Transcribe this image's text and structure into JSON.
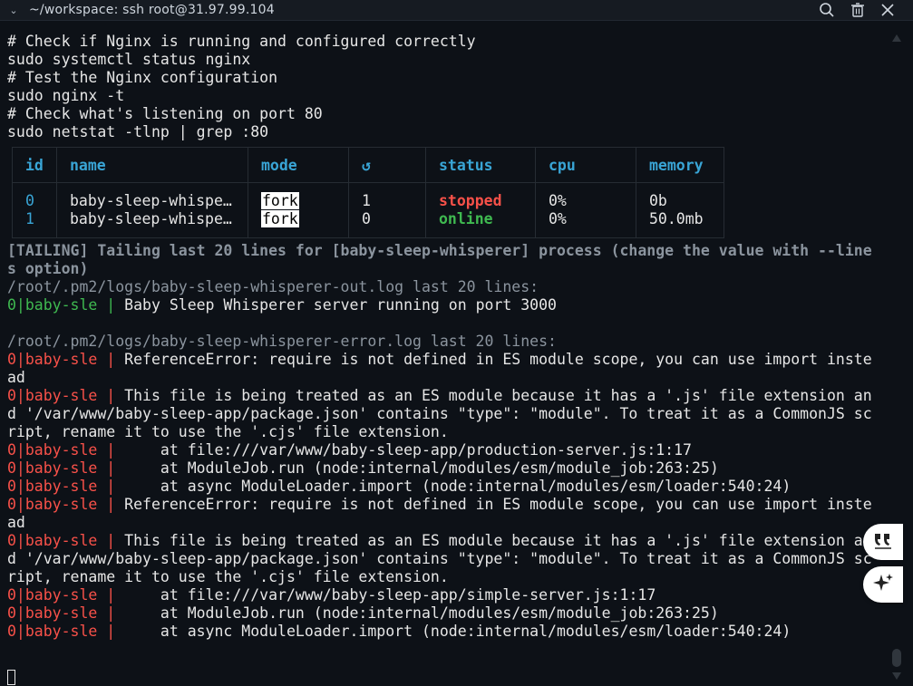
{
  "titlebar": {
    "chevron_icon": "chevron-down-icon",
    "title": "~/workspace: ssh root@31.97.99.104",
    "icons": [
      "search-icon",
      "trash-icon",
      "close-icon"
    ]
  },
  "commands": [
    "# Check if Nginx is running and configured correctly",
    "sudo systemctl status nginx",
    "# Test the Nginx configuration",
    "sudo nginx -t",
    "# Check what's listening on port 80",
    "sudo netstat -tlnp | grep :80"
  ],
  "pm2_table": {
    "headers": [
      "id",
      "name",
      "mode",
      "↺",
      "status",
      "cpu",
      "memory"
    ],
    "rows": [
      {
        "id": "0",
        "name": "baby-sleep-whispe…",
        "mode": "fork",
        "restarts": "1",
        "status": "stopped",
        "cpu": "0%",
        "memory": "0b"
      },
      {
        "id": "1",
        "name": "baby-sleep-whispe…",
        "mode": "fork",
        "restarts": "0",
        "status": "online",
        "cpu": "0%",
        "memory": "50.0mb"
      }
    ],
    "status_colors": {
      "stopped": "#f85149",
      "online": "#3fb950"
    }
  },
  "log": {
    "tailing_1": "[TAILING] Tailing last 20 lines for [baby-sleep-whisperer] process (change the value with --line",
    "tailing_2": "s option)",
    "out_path": "/root/.pm2/logs/baby-sleep-whisperer-out.log last 20 lines:",
    "prefix": "0|baby-sle |",
    "out_msg": " Baby Sleep Whisperer server running on port 3000",
    "err_path": "/root/.pm2/logs/baby-sleep-whisperer-error.log last 20 lines:",
    "e1": " ReferenceError: require is not defined in ES module scope, you can use import inste",
    "e1b": "ad",
    "e2": " This file is being treated as an ES module because it has a '.js' file extension an",
    "e2b": "d '/var/www/baby-sleep-app/package.json' contains \"type\": \"module\". To treat it as a CommonJS sc",
    "e2c": "ript, rename it to use the '.cjs' file extension.",
    "e3": "     at file:///var/www/baby-sleep-app/production-server.js:1:17",
    "e4": "     at ModuleJob.run (node:internal/modules/esm/module_job:263:25)",
    "e5": "     at async ModuleLoader.import (node:internal/modules/esm/loader:540:24)",
    "e6": " ReferenceError: require is not defined in ES module scope, you can use import inste",
    "e6b": "ad",
    "e7": " This file is being treated as an ES module because it has a '.js' file extension a",
    "e7b": "d '/var/www/baby-sleep-app/package.json' contains \"type\": \"module\". To treat it as a CommonJS sc",
    "e7c": "ript, rename it to use the '.cjs' file extension.",
    "e8": "     at file:///var/www/baby-sleep-app/simple-server.js:1:17",
    "e9": "     at ModuleJob.run (node:internal/modules/esm/module_job:263:25)",
    "e10": "     at async ModuleLoader.import (node:internal/modules/esm/loader:540:24)"
  },
  "floating_buttons": [
    "quote-icon",
    "sparkle-icon"
  ],
  "colors": {
    "background": "#0d1117",
    "red": "#f85149",
    "green": "#3fb950",
    "cyan": "#39a5d6",
    "gray": "#8b949e"
  }
}
